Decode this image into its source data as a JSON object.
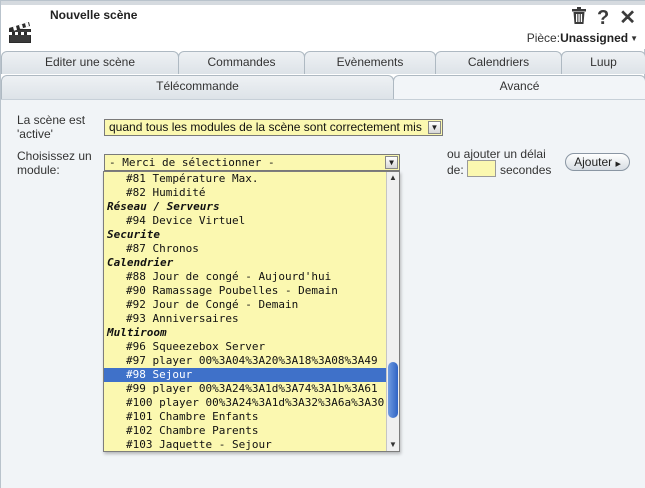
{
  "header": {
    "title": "Nouvelle scène",
    "icons": [
      "trash-icon",
      "help-icon",
      "close-icon"
    ],
    "piece_label": "Pièce:",
    "piece_value": "Unassigned"
  },
  "tabs_row1": [
    "Editer une scène",
    "Commandes",
    "Evènements",
    "Calendriers",
    "Luup"
  ],
  "tabs_row2": [
    "Télécommande",
    "Avancé"
  ],
  "form": {
    "active_label_1": "La scène est",
    "active_label_2": "'active'",
    "active_value": "quand tous les modules de la scène sont correctement mis",
    "module_label_1": "Choisissez un",
    "module_label_2": "module:",
    "module_value": "- Merci de sélectionner -",
    "delay_label_1": "ou ajouter un délai",
    "delay_label_2": "de:",
    "delay_value": "",
    "seconds_label": "secondes",
    "add_button": "Ajouter"
  },
  "dropdown_options": [
    {
      "type": "item",
      "text": "#81 Température Max."
    },
    {
      "type": "item",
      "text": "#82 Humidité"
    },
    {
      "type": "group",
      "text": "Réseau / Serveurs"
    },
    {
      "type": "item",
      "text": "#94 Device Virtuel"
    },
    {
      "type": "group",
      "text": "Securite"
    },
    {
      "type": "item",
      "text": "#87 Chronos"
    },
    {
      "type": "group",
      "text": "Calendrier"
    },
    {
      "type": "item",
      "text": "#88 Jour de congé - Aujourd'hui"
    },
    {
      "type": "item",
      "text": "#90 Ramassage Poubelles - Demain"
    },
    {
      "type": "item",
      "text": "#92 Jour de Congé - Demain"
    },
    {
      "type": "item",
      "text": "#93 Anniversaires"
    },
    {
      "type": "group",
      "text": "Multiroom"
    },
    {
      "type": "item",
      "text": "#96 Squeezebox Server"
    },
    {
      "type": "item",
      "text": "#97 player 00%3A04%3A20%3A18%3A08%3A49"
    },
    {
      "type": "item",
      "text": "#98 Sejour",
      "selected": true
    },
    {
      "type": "item",
      "text": "#99 player 00%3A24%3A1d%3A74%3A1b%3A61"
    },
    {
      "type": "item",
      "text": "#100 player 00%3A24%3A1d%3A32%3A6a%3A30"
    },
    {
      "type": "item",
      "text": "#101 Chambre Enfants"
    },
    {
      "type": "item",
      "text": "#102 Chambre Parents"
    },
    {
      "type": "item",
      "text": "#103 Jaquette - Sejour"
    }
  ],
  "colors": {
    "select_bg": "#fbf8b0",
    "highlight": "#3f71c9",
    "panel_bg": "#f1f4f7"
  }
}
